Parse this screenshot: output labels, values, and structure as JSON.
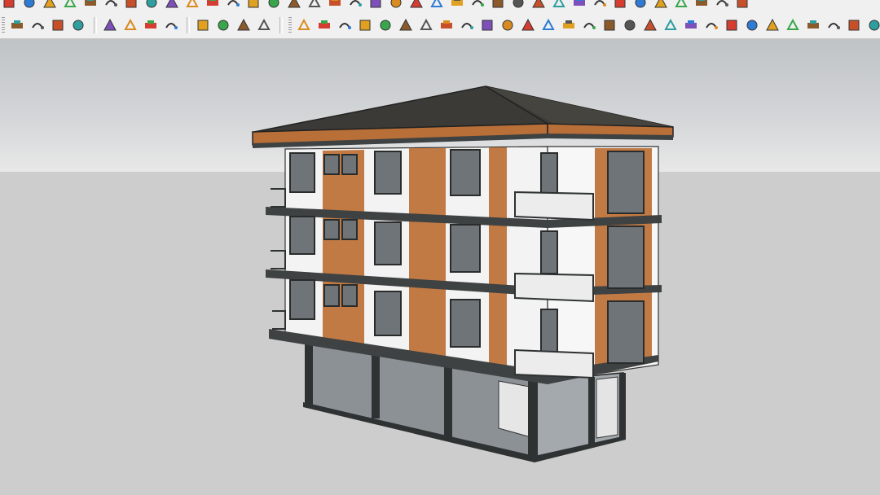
{
  "toolbar": {
    "row1_icons": [
      "section-plane-icon",
      "paint-bucket-icon",
      "eraser-icon",
      "tag-icon",
      "materials-icon",
      "component-icon",
      "undo-icon",
      "delete-icon",
      "save-icon",
      "flag-icon",
      "push-pull-icon",
      "orbit-icon",
      "question-icon",
      "add-red-icon",
      "add-green-icon",
      "move-icon",
      "person-icon",
      "person-alt-icon",
      "warning-icon",
      "loop-icon",
      "loop-alt-icon",
      "rotate-icon",
      "shape-icon",
      "bookmark-icon",
      "leaf-icon",
      "group-icon",
      "copy-icon",
      "export-icon",
      "shield-icon",
      "tree-icon",
      "grid-icon",
      "grid-alt-icon",
      "grid-orange-icon",
      "close-x-icon",
      "scale-icon",
      "layers-icon",
      "monitor-icon"
    ],
    "row2_left_icons": [
      "extension-warehouse-icon",
      "refresh-icon",
      "swap-icon",
      "zoom-extents-icon",
      "add-location-icon",
      "terrain-icon",
      "sun-icon",
      "checker-icon",
      "cloud-upload-icon",
      "gear-icon",
      "email-icon",
      "info-icon"
    ],
    "row2_right_icons": [
      "freehand-icon",
      "arc-icon",
      "curve-icon",
      "select-icon",
      "bezier-icon",
      "shape-cloud-icon",
      "lasso-icon",
      "box-icon",
      "rotate3d-icon",
      "snap-icon",
      "line-a-icon",
      "line-b-icon",
      "angle-icon",
      "extrude-icon",
      "arch-icon",
      "rail-icon",
      "protractor-icon",
      "columns-icon",
      "columns-alt-icon",
      "cylinder-icon",
      "panel-icon",
      "pyramid-icon",
      "stairs-icon",
      "ramp-icon",
      "slope-icon",
      "branch-icon",
      "branch-alt-icon",
      "cube-icon",
      "wide-panel-icon"
    ]
  },
  "viewport": {
    "sky_color": "#d4d6d8",
    "ground_color": "#cdcdcd",
    "colors": {
      "roof": "#3b3a36",
      "fascia": "#b86f38",
      "wood": "#c27a44",
      "wall": "#f3f3f3",
      "trim": "#3f4242",
      "glass": "#9aa0a6"
    }
  }
}
